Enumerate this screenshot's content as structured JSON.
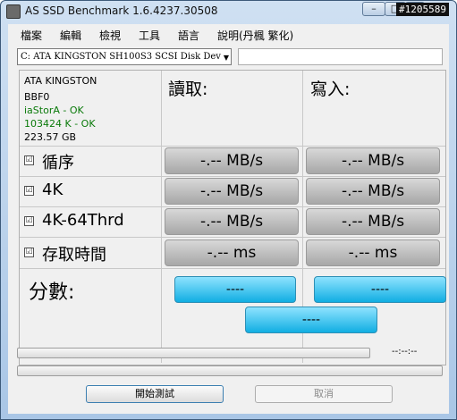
{
  "window": {
    "title": "AS SSD Benchmark 1.6.4237.30508",
    "watermark": "#1205589",
    "min_glyph": "–",
    "max_glyph": "□",
    "close_glyph": "x"
  },
  "menu": [
    "檔案",
    "編輯",
    "檢視",
    "工具",
    "語言",
    "說明(丹楓 繁化)"
  ],
  "drive": {
    "selected": "C: ATA KINGSTON SH100S3 SCSI Disk Dev",
    "arrow": "▼"
  },
  "info": {
    "model": "ATA KINGSTON",
    "firmware": "BBF0",
    "driver": "iaStorA - OK",
    "alignment": "103424 K - OK",
    "size": "223.57 GB"
  },
  "columns": {
    "read": "讀取:",
    "write": "寫入:"
  },
  "rows": [
    {
      "label": "循序",
      "checked": true,
      "check_glyph": "☑",
      "read": "-.-- MB/s",
      "write": "-.-- MB/s"
    },
    {
      "label": "4K",
      "checked": true,
      "check_glyph": "☑",
      "read": "-.-- MB/s",
      "write": "-.-- MB/s"
    },
    {
      "label": "4K-64Thrd",
      "checked": true,
      "check_glyph": "☑",
      "read": "-.-- MB/s",
      "write": "-.-- MB/s"
    },
    {
      "label": "存取時間",
      "checked": true,
      "check_glyph": "☑",
      "read": "-.-- ms",
      "write": "-.-- ms"
    }
  ],
  "score": {
    "label": "分數:",
    "read": "----",
    "write": "----",
    "total": "----"
  },
  "progress": {
    "time": "--:--:--",
    "value": 0
  },
  "buttons": {
    "start": "開始測試",
    "cancel": "取消"
  },
  "colors": {
    "ok_text": "#0a7a0a",
    "score_bg": "#11aee2",
    "result_bg": "#a7a7a7"
  }
}
